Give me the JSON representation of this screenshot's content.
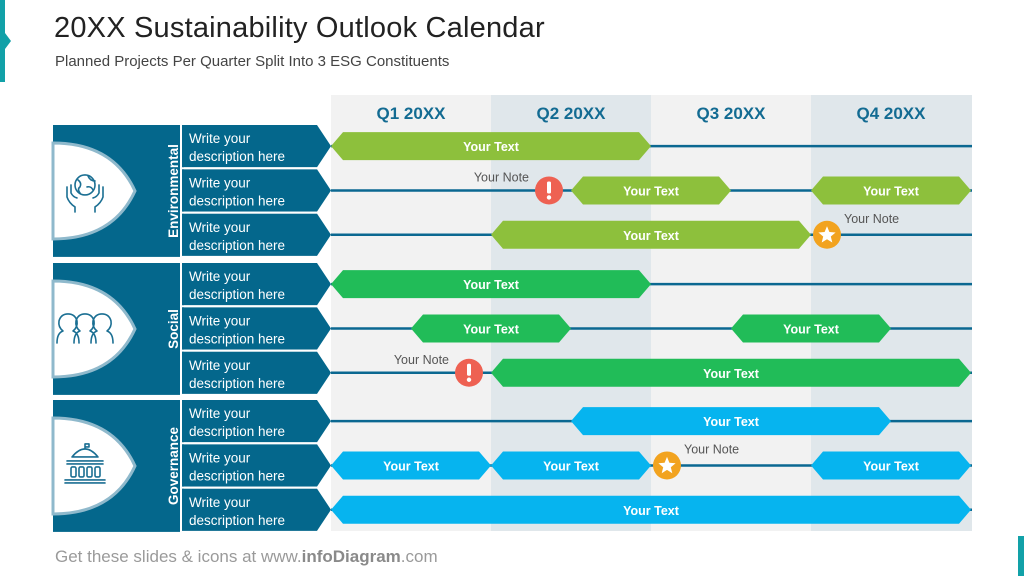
{
  "header": {
    "title": "20XX Sustainability Outlook Calendar",
    "subtitle": "Planned Projects Per Quarter Split Into 3 ESG Constituents"
  },
  "footer": {
    "prefix": "Get these slides & icons at www.",
    "brand": "infoDiagram",
    "suffix": ".com"
  },
  "colors": {
    "panel": "#04678c",
    "line": "#0b6891",
    "environmental": "#8dc03c",
    "social": "#21bc58",
    "governance": "#06b4ef",
    "alert": "#ee6152",
    "milestone": "#f2a31f",
    "quarter_odd": "#f2f2f2",
    "quarter_even": "#e0e7eb"
  },
  "chart_data": {
    "type": "gantt",
    "title": "20XX Sustainability Outlook Calendar",
    "quarters": [
      "Q1 20XX",
      "Q2 20XX",
      "Q3 20XX",
      "Q4 20XX"
    ],
    "x_range_quarters": [
      0,
      4
    ],
    "groups": [
      {
        "name": "Environmental",
        "icon": "globe-in-hands-icon",
        "rows": [
          {
            "description": "Write your description here",
            "bars": [
              {
                "start": 0.0,
                "end": 2.0,
                "label": "Your Text"
              }
            ],
            "markers": []
          },
          {
            "description": "Write your description here",
            "bars": [
              {
                "start": 1.5,
                "end": 2.5,
                "label": "Your Text"
              },
              {
                "start": 3.0,
                "end": 4.0,
                "label": "Your Text"
              }
            ],
            "markers": [
              {
                "type": "alert",
                "at": 1.4,
                "note": "Your Note"
              }
            ]
          },
          {
            "description": "Write your description here",
            "bars": [
              {
                "start": 1.0,
                "end": 3.0,
                "label": "Your Text"
              }
            ],
            "markers": [
              {
                "type": "star",
                "at": 3.1,
                "note": "Your Note"
              }
            ]
          }
        ]
      },
      {
        "name": "Social",
        "icon": "people-group-icon",
        "rows": [
          {
            "description": "Write your description here",
            "bars": [
              {
                "start": 0.0,
                "end": 2.0,
                "label": "Your Text"
              }
            ],
            "markers": []
          },
          {
            "description": "Write your description here",
            "bars": [
              {
                "start": 0.5,
                "end": 1.5,
                "label": "Your Text"
              },
              {
                "start": 2.5,
                "end": 3.5,
                "label": "Your Text"
              }
            ],
            "markers": []
          },
          {
            "description": "Write your description here",
            "bars": [
              {
                "start": 1.0,
                "end": 4.0,
                "label": "Your Text"
              }
            ],
            "markers": [
              {
                "type": "alert",
                "at": 0.9,
                "note": "Your Note"
              }
            ]
          }
        ]
      },
      {
        "name": "Governance",
        "icon": "government-building-icon",
        "rows": [
          {
            "description": "Write your description here",
            "bars": [
              {
                "start": 1.5,
                "end": 3.5,
                "label": "Your Text"
              }
            ],
            "markers": []
          },
          {
            "description": "Write your description here",
            "bars": [
              {
                "start": 0.0,
                "end": 1.0,
                "label": "Your Text"
              },
              {
                "start": 1.0,
                "end": 2.0,
                "label": "Your Text"
              },
              {
                "start": 3.0,
                "end": 4.0,
                "label": "Your Text"
              }
            ],
            "markers": [
              {
                "type": "star",
                "at": 2.1,
                "note": "Your Note"
              }
            ]
          },
          {
            "description": "Write your description here",
            "bars": [
              {
                "start": 0.0,
                "end": 4.0,
                "label": "Your Text"
              }
            ],
            "markers": []
          }
        ]
      }
    ]
  }
}
